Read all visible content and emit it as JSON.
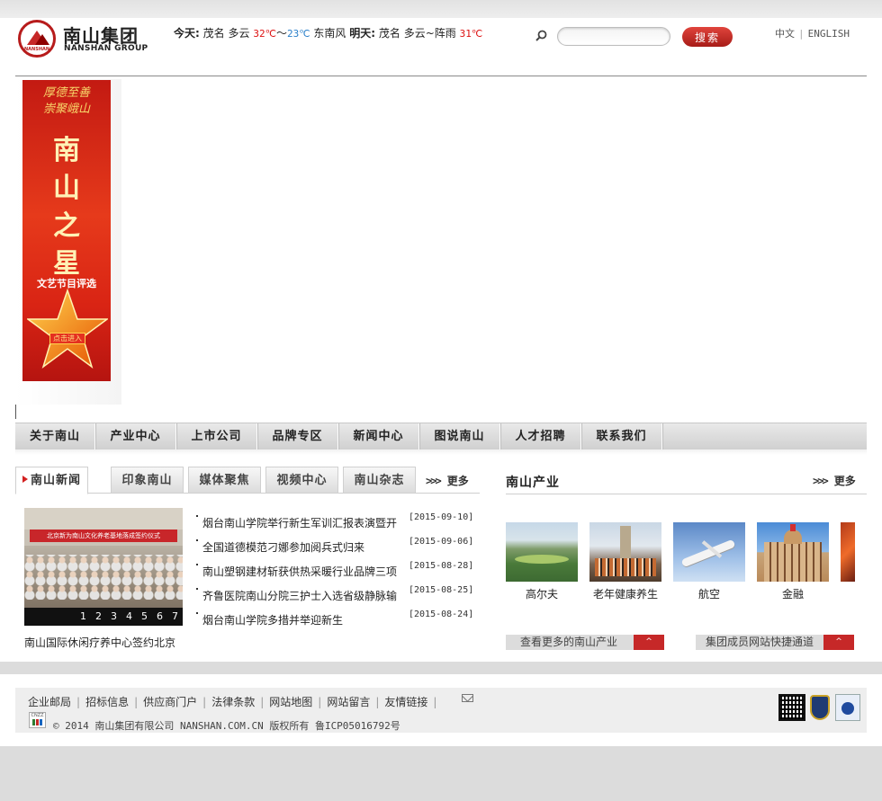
{
  "header": {
    "logo_cn": "南山集团",
    "logo_en": "NANSHAN GROUP",
    "logo_mark_text": "NANSHAN",
    "weather": {
      "today_label": "今天:",
      "today_city": "茂名",
      "today_sky": "多云",
      "today_high": "32℃",
      "tilde": "～",
      "today_low": "23℃",
      "today_wind": "东南风",
      "tomorrow_label": "明天:",
      "tomorrow_city": "茂名",
      "tomorrow_sky": "多云~阵雨",
      "tomorrow_temp": "31℃"
    },
    "search": {
      "placeholder": "",
      "button_label": "搜索"
    },
    "lang": {
      "cn": "中文",
      "en": "ENGLISH",
      "sep": "|"
    }
  },
  "banner": {
    "top_text_1": "厚德至善",
    "top_text_2": "崇聚峨山",
    "title_1": "南",
    "title_2": "山",
    "title_3": "之",
    "title_4": "星",
    "subtitle": "文艺节目评选",
    "enter_label": "点击进入"
  },
  "nav": {
    "items": [
      {
        "label": "关于南山"
      },
      {
        "label": "产业中心"
      },
      {
        "label": "上市公司"
      },
      {
        "label": "品牌专区"
      },
      {
        "label": "新闻中心"
      },
      {
        "label": "图说南山"
      },
      {
        "label": "人才招聘"
      },
      {
        "label": "联系我们"
      }
    ]
  },
  "news": {
    "tabs": [
      {
        "label": "南山新闻"
      },
      {
        "label": "印象南山"
      },
      {
        "label": "媒体聚焦"
      },
      {
        "label": "视频中心"
      },
      {
        "label": "南山杂志"
      }
    ],
    "more_label": "更多",
    "more_arrows": ">>>",
    "photo_banner_text": "北京新为南山文化养老基地落成签约仪式",
    "slider_numbers": [
      "1",
      "2",
      "3",
      "4",
      "5",
      "6",
      "7"
    ],
    "photo_caption": "南山国际休闲疗养中心签约北京",
    "items": [
      {
        "title": "烟台南山学院举行新生军训汇报表演暨开",
        "date": "[2015-09-10]"
      },
      {
        "title": "全国道德模范刁娜参加阅兵式归来",
        "date": "[2015-09-06]"
      },
      {
        "title": "南山塑钢建材斩获供热采暖行业品牌三项",
        "date": "[2015-08-28]"
      },
      {
        "title": "齐鲁医院南山分院三护士入选省级静脉输",
        "date": "[2015-08-25]"
      },
      {
        "title": "烟台南山学院多措并举迎新生",
        "date": "[2015-08-24]"
      }
    ]
  },
  "industry": {
    "title": "南山产业",
    "more_label": "更多",
    "more_arrows": ">>>",
    "items": [
      {
        "label": "高尔夫"
      },
      {
        "label": "老年健康养生"
      },
      {
        "label": "航空"
      },
      {
        "label": "金融"
      }
    ],
    "more_btn": "查看更多的南山产业",
    "members_btn": "集团成员网站快捷通道",
    "caret": "^"
  },
  "footer": {
    "links": [
      {
        "label": "企业邮局"
      },
      {
        "label": "招标信息"
      },
      {
        "label": "供应商门户"
      },
      {
        "label": "法律条款"
      },
      {
        "label": "网站地图"
      },
      {
        "label": "网站留言"
      },
      {
        "label": "友情链接"
      }
    ],
    "sep": "|",
    "cnzz": "CNZZ",
    "copyright": "© 2014 南山集团有限公司 NANSHAN.COM.CN 版权所有 鲁ICP05016792号"
  }
}
